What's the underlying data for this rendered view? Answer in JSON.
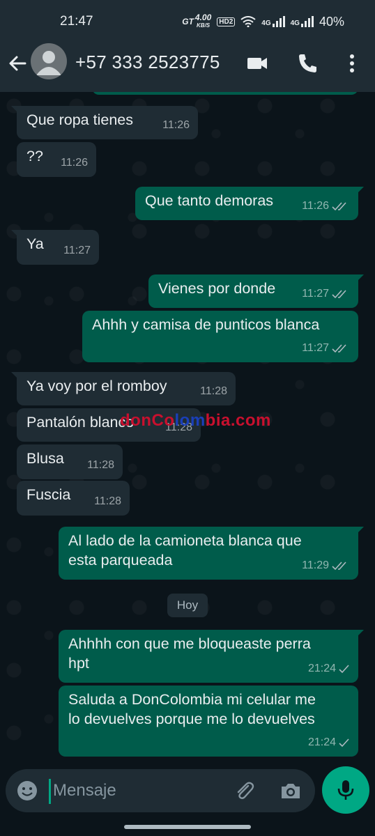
{
  "status_bar": {
    "time": "21:47",
    "network_speed_value": "4.00",
    "network_speed_unit": "KB/S",
    "network_prefix": "GT",
    "hd_label": "HD2",
    "sim1_label": "4G",
    "sim2_label": "4G",
    "battery": "40%"
  },
  "header": {
    "contact": "+57 333 2523775",
    "icons": [
      "back-arrow-icon",
      "avatar",
      "video-call-icon",
      "phone-icon",
      "more-icon"
    ]
  },
  "messages": [
    {
      "dir": "in",
      "text": "Que ropa tienes",
      "time": "11:26"
    },
    {
      "dir": "in",
      "text": "??",
      "time": "11:26"
    },
    {
      "dir": "out",
      "text": "Que tanto demoras",
      "time": "11:26",
      "status": "read"
    },
    {
      "dir": "in",
      "text": "Ya",
      "time": "11:27"
    },
    {
      "dir": "out",
      "text": "Vienes por donde",
      "time": "11:27",
      "status": "read"
    },
    {
      "dir": "out",
      "text": "Ahhh y camisa de punticos blanca",
      "time": "11:27",
      "status": "read"
    },
    {
      "dir": "in",
      "text": "Ya voy por el romboy",
      "time": "11:28"
    },
    {
      "dir": "in",
      "text": "Pantalón blanco",
      "time": "11:28"
    },
    {
      "dir": "in",
      "text": "Blusa",
      "time": "11:28"
    },
    {
      "dir": "in",
      "text": "Fuscia",
      "time": "11:28"
    },
    {
      "dir": "out",
      "text_line1": "Al lado de la camioneta blanca que",
      "text_line2": "esta parqueada",
      "time": "11:29",
      "status": "read"
    },
    {
      "dir": "out",
      "text_line1": "Ahhhh con que me bloqueaste perra",
      "text_line2": "hpt",
      "time": "21:24",
      "status": "sent"
    },
    {
      "dir": "out",
      "text_line1": "Saluda a DonColombia mi celular me",
      "text_line2": "lo devuelves porque me lo devuelves",
      "time": "21:24",
      "status": "sent"
    }
  ],
  "date_separator": "Hoy",
  "watermark": {
    "part1": "donCo",
    "part2": "lom",
    "part3": "bia.com"
  },
  "composer": {
    "placeholder": "Mensaje"
  },
  "colors": {
    "background": "#0b141a",
    "bar": "#1f2c34",
    "incoming": "#1f2c34",
    "outgoing": "#005c4b",
    "accent": "#00a884"
  }
}
